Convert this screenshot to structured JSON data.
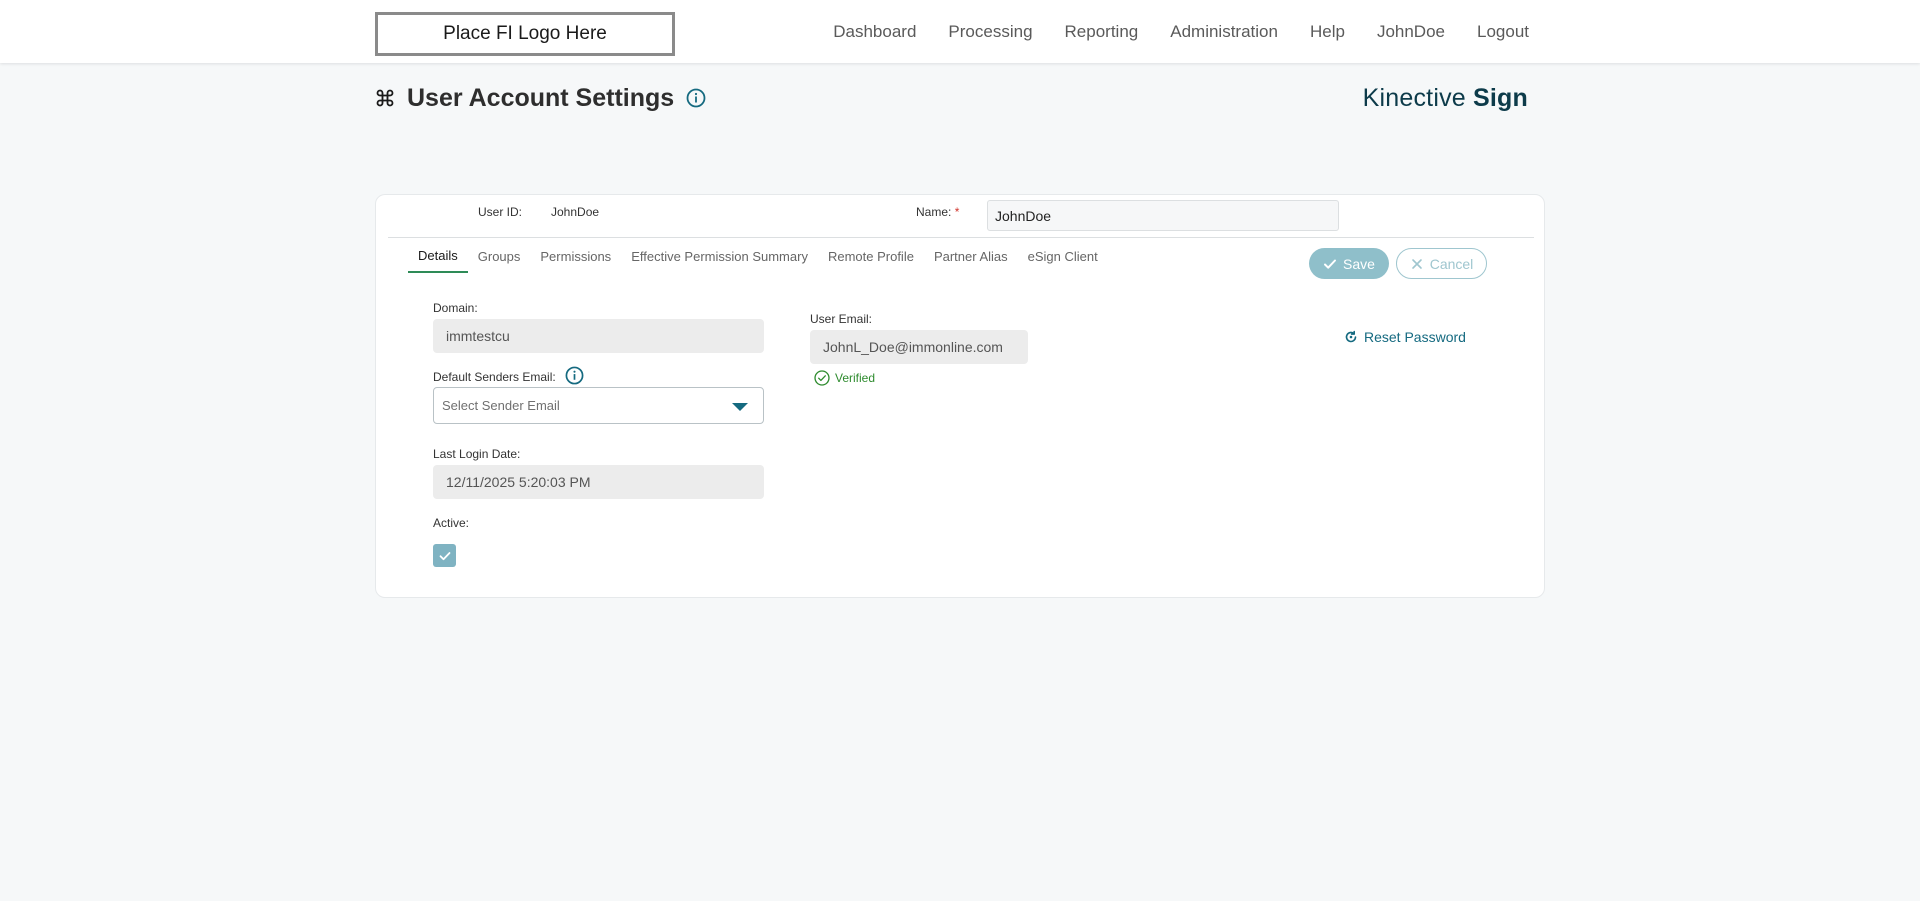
{
  "header": {
    "logo_text": "Place FI Logo Here",
    "nav": [
      "Dashboard",
      "Processing",
      "Reporting",
      "Administration",
      "Help",
      "JohnDoe",
      "Logout"
    ]
  },
  "page": {
    "title": "User Account Settings",
    "title_icon": "command-icon",
    "brand_light": "Kinective ",
    "brand_bold": "Sign"
  },
  "user": {
    "id_label": "User ID:",
    "id_value": "JohnDoe",
    "name_label": "Name:",
    "name_required": "*",
    "name_value": "JohnDoe"
  },
  "tabs": [
    {
      "label": "Details",
      "active": true
    },
    {
      "label": "Groups",
      "active": false
    },
    {
      "label": "Permissions",
      "active": false
    },
    {
      "label": "Effective Permission Summary",
      "active": false
    },
    {
      "label": "Remote Profile",
      "active": false
    },
    {
      "label": "Partner Alias",
      "active": false
    },
    {
      "label": "eSign Client",
      "active": false
    }
  ],
  "actions": {
    "save_label": "Save",
    "cancel_label": "Cancel",
    "reset_password_label": "Reset Password"
  },
  "details": {
    "domain_label": "Domain:",
    "domain_value": "immtestcu",
    "default_senders_label": "Default Senders Email:",
    "sender_placeholder": "Select Sender Email",
    "last_login_label": "Last Login Date:",
    "last_login_value": "12/11/2025 5:20:03 PM",
    "active_label": "Active:",
    "active_checked": true,
    "user_email_label": "User Email:",
    "user_email_value": "JohnL_Doe@immonline.com",
    "verified_label": "Verified"
  },
  "colors": {
    "accent": "#156a80",
    "tab_underline": "#2e8b57",
    "save_bg": "#8fbfca",
    "verified": "#2e8b2e",
    "required": "#d0342c"
  }
}
